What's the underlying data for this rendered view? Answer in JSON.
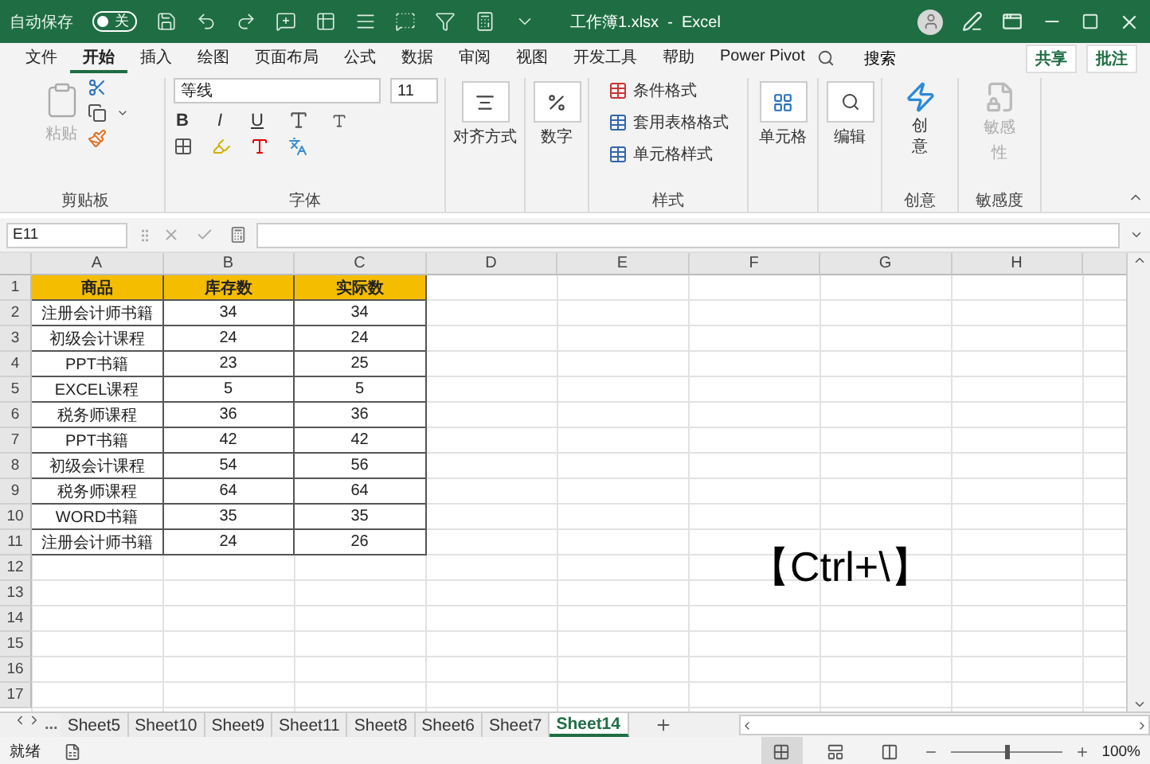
{
  "title_bar": {
    "autosave_label": "自动保存",
    "autosave_toggle": {
      "label": "关",
      "on": false
    },
    "document_title": "工作簿1.xlsx  -  Excel"
  },
  "menu_tabs": [
    {
      "label": "文件",
      "selected": false
    },
    {
      "label": "开始",
      "selected": true
    },
    {
      "label": "插入",
      "selected": false
    },
    {
      "label": "绘图",
      "selected": false
    },
    {
      "label": "页面布局",
      "selected": false
    },
    {
      "label": "公式",
      "selected": false
    },
    {
      "label": "数据",
      "selected": false
    },
    {
      "label": "审阅",
      "selected": false
    },
    {
      "label": "视图",
      "selected": false
    },
    {
      "label": "开发工具",
      "selected": false
    },
    {
      "label": "帮助",
      "selected": false
    },
    {
      "label": "Power Pivot",
      "selected": false
    }
  ],
  "search": {
    "label": "搜索"
  },
  "share_button": "共享",
  "comments_button": "批注",
  "ribbon": {
    "clipboard": {
      "paste": "粘贴",
      "label": "剪贴板"
    },
    "font": {
      "font_name": "等线",
      "font_size": "11",
      "bold": "B",
      "italic": "I",
      "underline": "U",
      "label": "字体"
    },
    "alignment": "对齐方式",
    "number": "数字",
    "styles": {
      "items": [
        "条件格式",
        "套用表格格式",
        "单元格样式"
      ],
      "label": "样式"
    },
    "cells": "单元格",
    "editing": "编辑",
    "ideas": {
      "button": "创意",
      "label": "创意"
    },
    "sensitivity": {
      "button": "敏感",
      "button_line2": "性",
      "disabled": true,
      "label": "敏感度"
    }
  },
  "formula_bar": {
    "name_box": "E11"
  },
  "sheet": {
    "columns": [
      "A",
      "B",
      "C",
      "D",
      "E",
      "F",
      "G",
      "H"
    ],
    "rows": [
      {
        "number": "1",
        "kind": "header",
        "cells": [
          "商品",
          "库存数",
          "实际数"
        ]
      },
      {
        "number": "2",
        "kind": "data",
        "cells": [
          "注册会计师书籍",
          "34",
          "34"
        ]
      },
      {
        "number": "3",
        "kind": "data",
        "cells": [
          "初级会计课程",
          "24",
          "24"
        ]
      },
      {
        "number": "4",
        "kind": "data",
        "cells": [
          "PPT书籍",
          "23",
          "25"
        ]
      },
      {
        "number": "5",
        "kind": "data",
        "cells": [
          "EXCEL课程",
          "5",
          "5"
        ]
      },
      {
        "number": "6",
        "kind": "data",
        "cells": [
          "税务师课程",
          "36",
          "36"
        ]
      },
      {
        "number": "7",
        "kind": "data",
        "cells": [
          "PPT书籍",
          "42",
          "42"
        ]
      },
      {
        "number": "8",
        "kind": "data",
        "cells": [
          "初级会计课程",
          "54",
          "56"
        ]
      },
      {
        "number": "9",
        "kind": "data",
        "cells": [
          "税务师课程",
          "64",
          "64"
        ]
      },
      {
        "number": "10",
        "kind": "data",
        "cells": [
          "WORD书籍",
          "35",
          "35"
        ]
      },
      {
        "number": "11",
        "kind": "data",
        "cells": [
          "注册会计师书籍",
          "24",
          "26"
        ]
      },
      {
        "number": "12",
        "kind": "empty"
      },
      {
        "number": "13",
        "kind": "empty"
      },
      {
        "number": "14",
        "kind": "empty"
      },
      {
        "number": "15",
        "kind": "empty"
      },
      {
        "number": "16",
        "kind": "empty"
      },
      {
        "number": "17",
        "kind": "empty"
      }
    ]
  },
  "overlay_caption": "【Ctrl+\\】",
  "sheet_tabs": {
    "more": "...",
    "tabs": [
      {
        "label": "Sheet5",
        "selected": false
      },
      {
        "label": "Sheet10",
        "selected": false
      },
      {
        "label": "Sheet9",
        "selected": false
      },
      {
        "label": "Sheet11",
        "selected": false
      },
      {
        "label": "Sheet8",
        "selected": false
      },
      {
        "label": "Sheet6",
        "selected": false
      },
      {
        "label": "Sheet7",
        "selected": false
      },
      {
        "label": "Sheet14",
        "selected": true
      }
    ]
  },
  "status_bar": {
    "status": "就绪",
    "views": [
      {
        "kind": "normal",
        "selected": true
      },
      {
        "kind": "page_layout",
        "selected": false
      },
      {
        "kind": "page_break",
        "selected": false
      }
    ],
    "zoom": {
      "level": 0.5,
      "reading": "100%"
    }
  }
}
